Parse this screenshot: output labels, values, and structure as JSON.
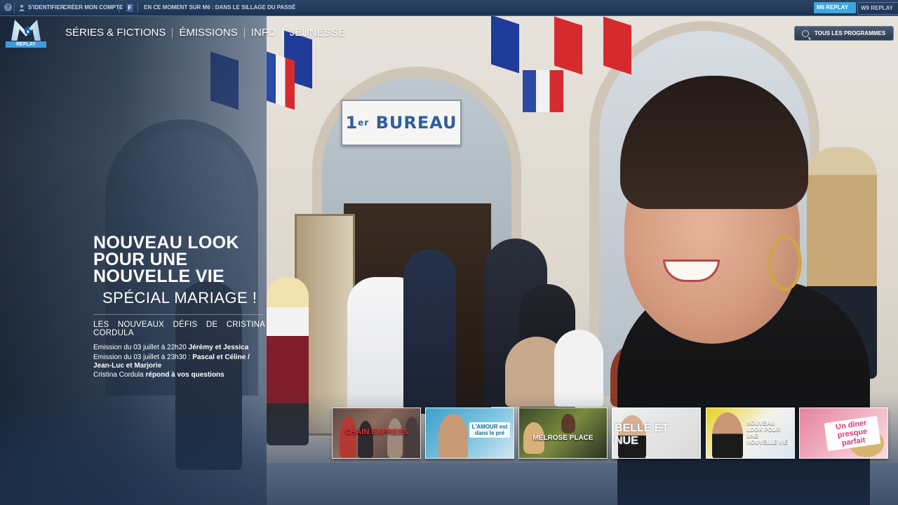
{
  "topbar": {
    "identify": "S'IDENTIFIER",
    "create_account": "CRÉER MON COMPTE",
    "facebook_glyph": "f",
    "now_on": "EN CE MOMENT SUR M6 : DANS LE SILLAGE DU PASSÉ",
    "brand_m6": "M6 REPLAY",
    "brand_w9": "W9 REPLAY"
  },
  "logo": {
    "six": "6",
    "replay": "REPLAY"
  },
  "nav": {
    "items": [
      "SÉRIES & FICTIONS",
      "ÉMISSIONS",
      "INFO",
      "JEUNESSE"
    ]
  },
  "programs_button": {
    "label": "TOUS LES PROGRAMMES"
  },
  "photo": {
    "sign": "BUREAU",
    "sign_prefix": "1",
    "sign_sup": "er"
  },
  "headline": {
    "title_lines": [
      "NOUVEAU LOOK",
      "POUR UNE",
      "NOUVELLE VIE"
    ],
    "subtitle": "SPÉCIAL MARIAGE !",
    "description": "LES NOUVEAUX DÉFIS DE CRISTINA CORDULA",
    "episodes": [
      {
        "prefix": "Emission du 03 juillet à 22h20 ",
        "bold": "Jérémy et Jessica"
      },
      {
        "prefix": "Emission du 03 juillet à 23h30 : ",
        "bold": "Pascal et Céline / Jean-Luc et Marjorie"
      },
      {
        "prefix": "Cristina Cordula ",
        "bold": "répond à vos questions"
      }
    ]
  },
  "thumbnails": [
    {
      "label": "CHAIN EXPRESS"
    },
    {
      "label": "L'AMOUR est dans le pré"
    },
    {
      "label": "MELROSE PLACE"
    },
    {
      "label": "BELLE ET NUE"
    },
    {
      "label": "NOUVEAU LOOK POUR UNE NOUVELLE VIE"
    },
    {
      "label": "Un dîner presque parfait"
    }
  ],
  "colors": {
    "topbar_bg": "#1d3250",
    "accent_blue": "#3d9be0",
    "facebook": "#3b5998"
  }
}
